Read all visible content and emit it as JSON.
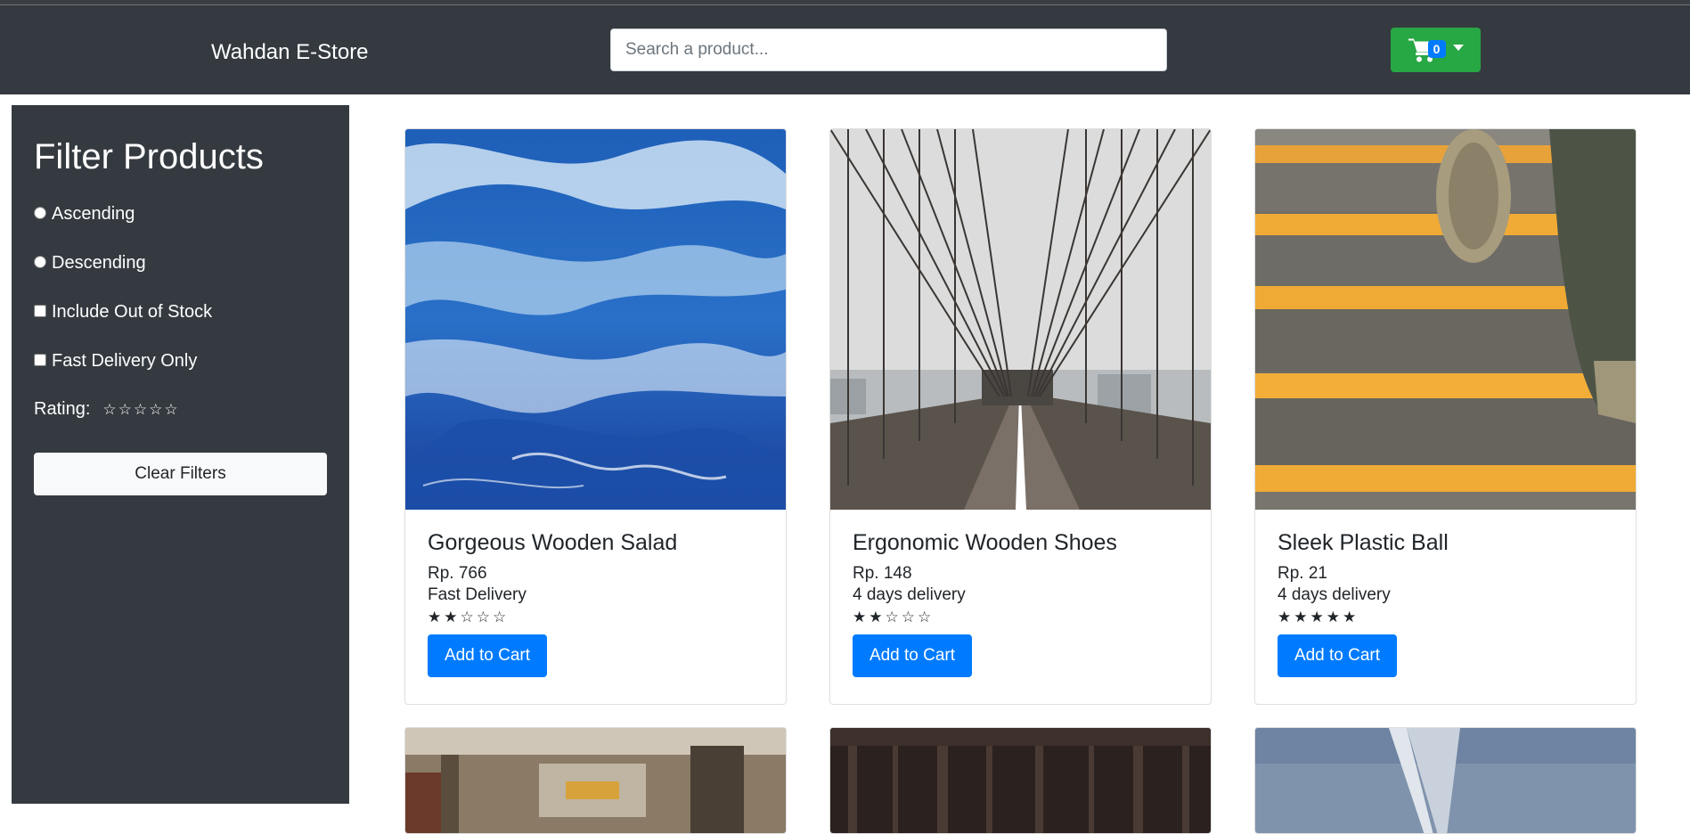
{
  "header": {
    "brand": "Wahdan E-Store",
    "search_placeholder": "Search a product...",
    "cart_count": "0"
  },
  "sidebar": {
    "title": "Filter Products",
    "options": [
      {
        "label": "Ascending",
        "type": "radio"
      },
      {
        "label": "Descending",
        "type": "radio"
      },
      {
        "label": "Include Out of Stock",
        "type": "checkbox"
      },
      {
        "label": "Fast Delivery Only",
        "type": "checkbox"
      }
    ],
    "rating_label": "Rating:",
    "rating_stars": [
      "☆",
      "☆",
      "☆",
      "☆",
      "☆"
    ],
    "rating_value": 0,
    "clear_label": "Clear Filters"
  },
  "products": [
    {
      "name": "Gorgeous Wooden Salad",
      "price": "Rp. 766",
      "delivery": "Fast Delivery",
      "stars": [
        "★",
        "★",
        "☆",
        "☆",
        "☆"
      ],
      "rating": 2,
      "button": "Add to Cart",
      "image": "ocean-waves"
    },
    {
      "name": "Ergonomic Wooden Shoes",
      "price": "Rp. 148",
      "delivery": "4 days delivery",
      "stars": [
        "★",
        "★",
        "☆",
        "☆",
        "☆"
      ],
      "rating": 2,
      "button": "Add to Cart",
      "image": "suspension-bridge"
    },
    {
      "name": "Sleek Plastic Ball",
      "price": "Rp. 21",
      "delivery": "4 days delivery",
      "stars": [
        "★",
        "★",
        "★",
        "★",
        "★"
      ],
      "rating": 5,
      "button": "Add to Cart",
      "image": "striped-stairs"
    }
  ],
  "partial_row_images": [
    "train-interior",
    "dark-forest",
    "sky-tower"
  ],
  "colors": {
    "navbar": "#343a40",
    "cart_button": "#28a745",
    "primary_button": "#007bff",
    "badge": "#007bff"
  }
}
